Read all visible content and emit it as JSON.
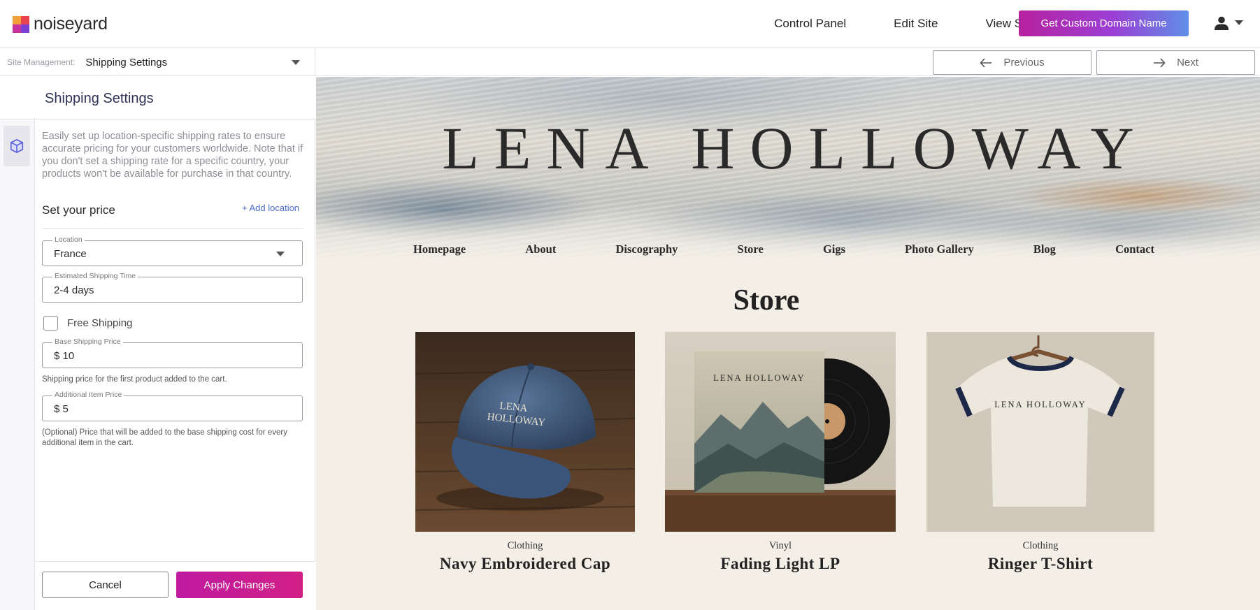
{
  "app": {
    "brand": "noiseyard",
    "colors": {
      "accent": "#c41f9e",
      "link": "#4a6cc9",
      "title": "#2f3356"
    }
  },
  "topbar": {
    "links": [
      "Control Panel",
      "Edit Site",
      "View Site"
    ],
    "domain_button": "Get Custom Domain Name",
    "user_icon": "user-icon"
  },
  "subbar": {
    "label": "Site Management:",
    "value": "Shipping Settings",
    "previous": "Previous",
    "next": "Next"
  },
  "panel": {
    "title": "Shipping Settings",
    "description": "Easily set up location-specific shipping rates to ensure accurate pricing for your customers worldwide. Note that if you don't set a shipping rate for a specific country, your products won't be available for purchase in that country.",
    "price_title": "Set your price",
    "add_location": "+ Add location",
    "location": {
      "label": "Location",
      "value": "France"
    },
    "shipping_time": {
      "label": "Estimated Shipping Time",
      "value": "2-4 days"
    },
    "free_shipping": {
      "label": "Free Shipping",
      "checked": false
    },
    "base_price": {
      "label": "Base Shipping Price",
      "value": "$ 10",
      "helper": "Shipping price for the first product added to the cart."
    },
    "additional_price": {
      "label": "Additional Item Price",
      "value": "$ 5",
      "helper": "(Optional) Price that will be added to the base shipping cost for every additional item in the cart."
    },
    "cancel": "Cancel",
    "apply": "Apply Changes"
  },
  "site": {
    "title": "LENA HOLLOWAY",
    "nav": [
      "Homepage",
      "About",
      "Discography",
      "Store",
      "Gigs",
      "Photo Gallery",
      "Blog",
      "Contact"
    ],
    "store_heading": "Store",
    "products": [
      {
        "category": "Clothing",
        "name": "Navy Embroidered Cap",
        "print": "LENA HOLLOWAY"
      },
      {
        "category": "Vinyl",
        "name": "Fading Light LP",
        "print": "LENA HOLLOWAY"
      },
      {
        "category": "Clothing",
        "name": "Ringer T-Shirt",
        "print": "LENA HOLLOWAY"
      }
    ]
  }
}
